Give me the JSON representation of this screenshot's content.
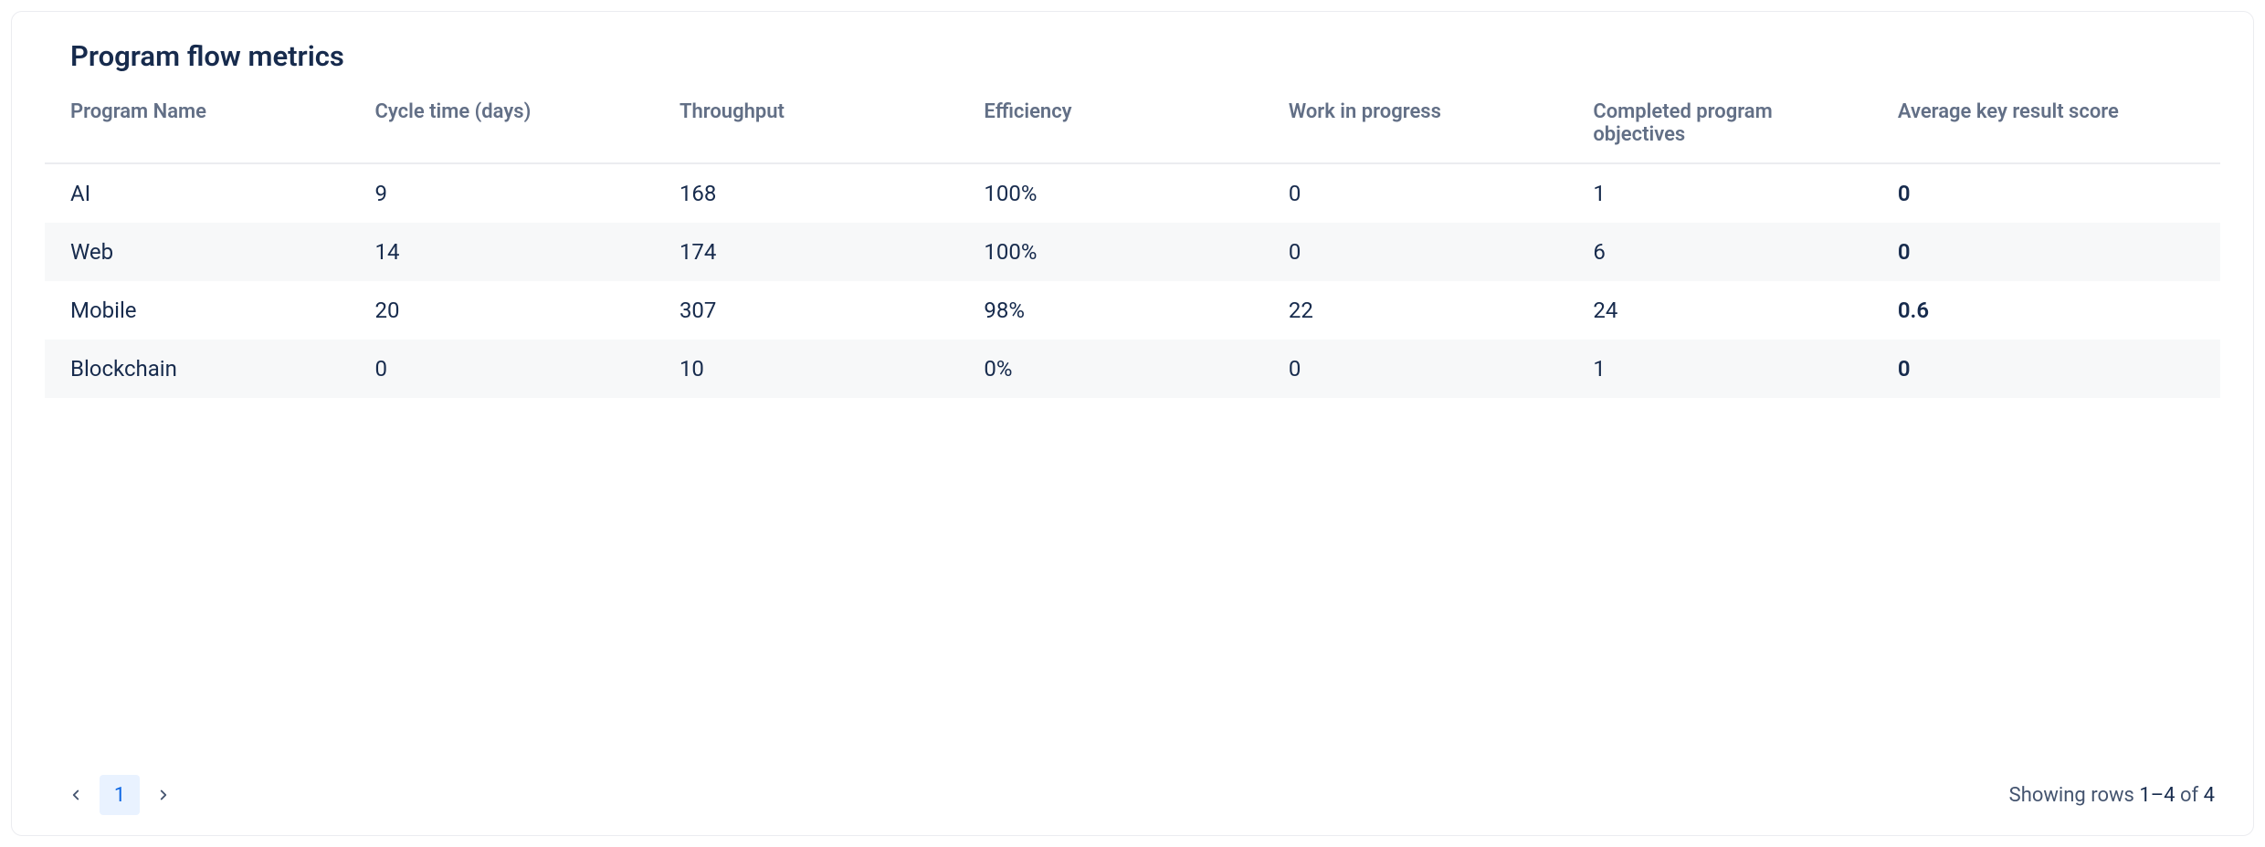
{
  "title": "Program flow metrics",
  "columns": [
    "Program Name",
    "Cycle time (days)",
    "Throughput",
    "Efficiency",
    "Work in progress",
    "Completed program objectives",
    "Average key result score"
  ],
  "rows": [
    {
      "name": "AI",
      "cycle": "9",
      "throughput": "168",
      "efficiency": "100%",
      "wip": "0",
      "completed": "1",
      "score": "0",
      "score_class": "score-red"
    },
    {
      "name": "Web",
      "cycle": "14",
      "throughput": "174",
      "efficiency": "100%",
      "wip": "0",
      "completed": "6",
      "score": "0",
      "score_class": "score-red"
    },
    {
      "name": "Mobile",
      "cycle": "20",
      "throughput": "307",
      "efficiency": "98%",
      "wip": "22",
      "completed": "24",
      "score": "0.6",
      "score_class": "score-amber"
    },
    {
      "name": "Blockchain",
      "cycle": "0",
      "throughput": "10",
      "efficiency": "0%",
      "wip": "0",
      "completed": "1",
      "score": "0",
      "score_class": "score-red"
    }
  ],
  "pagination": {
    "current_page": "1",
    "rows_label": "Showing rows ",
    "range": "1–4",
    "of": " of ",
    "total": "4"
  }
}
